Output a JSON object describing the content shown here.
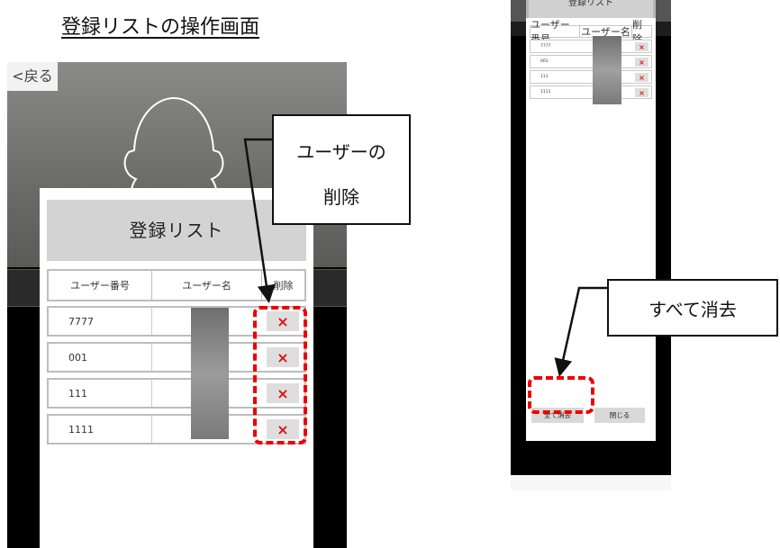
{
  "heading": "登録リストの操作画面",
  "left_screen": {
    "back_label": "<戻る",
    "dialog_title": "登録リスト",
    "columns": [
      "ユーザー番号",
      "ユーザー名",
      "削除"
    ],
    "rows": [
      {
        "number": "7777",
        "delete_icon": "×"
      },
      {
        "number": "001",
        "delete_icon": "×"
      },
      {
        "number": "111",
        "delete_icon": "×"
      },
      {
        "number": "1111",
        "delete_icon": "×"
      }
    ]
  },
  "right_screen": {
    "dialog_title": "登録リスト",
    "columns": [
      "ユーザー番号",
      "ユーザー名",
      "削除"
    ],
    "rows": [
      {
        "number": "7777",
        "delete_icon": "×"
      },
      {
        "number": "001",
        "delete_icon": "×"
      },
      {
        "number": "111",
        "delete_icon": "×"
      },
      {
        "number": "1111",
        "delete_icon": "×"
      }
    ],
    "clear_all_label": "全て消去",
    "close_label": "閉じる"
  },
  "callouts": {
    "delete_user_line1": "ユーザーの",
    "delete_user_line2": "削除",
    "clear_all": "すべて消去"
  },
  "colors": {
    "highlight": "#e00000",
    "delete_icon": "#dd1111"
  }
}
